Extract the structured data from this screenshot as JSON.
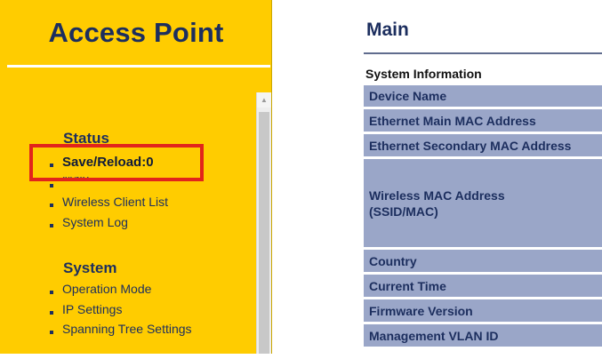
{
  "sidebar": {
    "title": "Access Point",
    "sections": [
      {
        "heading": "Status",
        "items": [
          {
            "label": "Save/Reload:0"
          },
          {
            "label": "Main"
          },
          {
            "label": "Wireless Client List"
          },
          {
            "label": "System Log"
          }
        ]
      },
      {
        "heading": "System",
        "items": [
          {
            "label": "Operation Mode"
          },
          {
            "label": "IP Settings"
          },
          {
            "label": "Spanning Tree Settings"
          }
        ]
      }
    ]
  },
  "main": {
    "title": "Main",
    "section_label": "System Information",
    "rows": [
      {
        "label": "Device Name"
      },
      {
        "label": "Ethernet Main MAC Address"
      },
      {
        "label": "Ethernet Secondary MAC Address"
      },
      {
        "label": "Wireless MAC Address\n(SSID/MAC)"
      },
      {
        "label": "Country"
      },
      {
        "label": "Current Time"
      },
      {
        "label": "Firmware Version"
      },
      {
        "label": "Management VLAN ID"
      }
    ]
  },
  "colors": {
    "sidebar_bg": "#ffcc00",
    "text_navy": "#1c2e5e",
    "row_bg": "#9aa6c8",
    "highlight_red": "#e2241b"
  },
  "icons": {
    "scroll_up": "scroll-up-arrow-icon",
    "bullet": "bullet-icon"
  }
}
